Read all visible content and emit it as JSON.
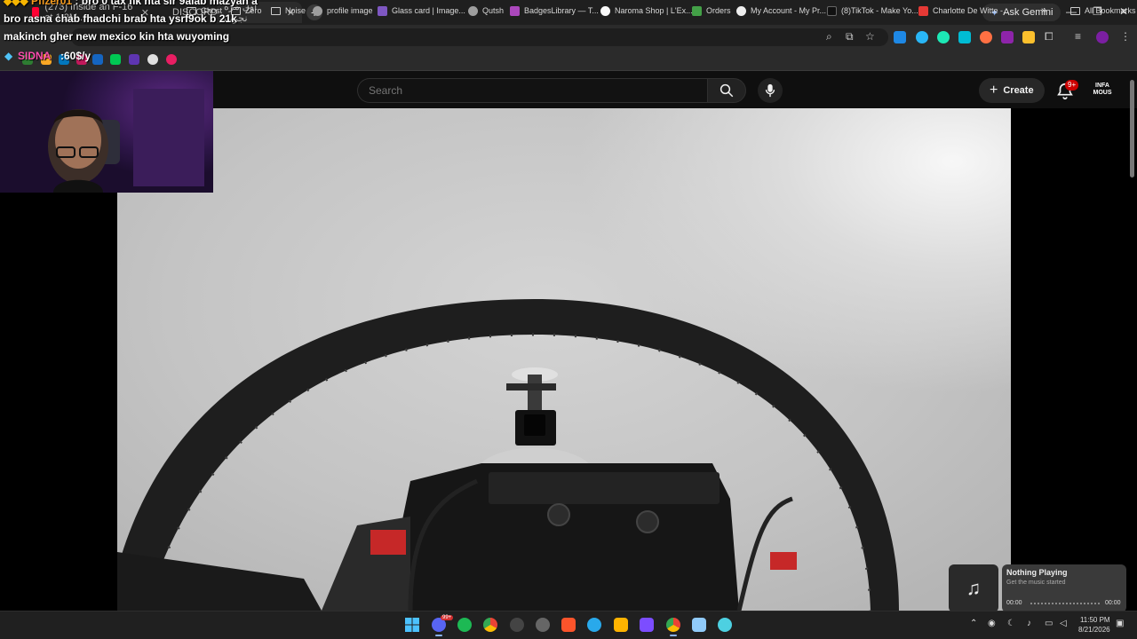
{
  "browser": {
    "tabs": [
      {
        "label": "(273) Inside an F-16 at 1.2M..."
      },
      {
        "label": "DISCORD"
      },
      {
        "label": "أول مرة نجرب"
      }
    ],
    "ask_gemini": "Ask Gemini",
    "bookmarks": [
      {
        "label": "Ghost",
        "icon": "folder-icon"
      },
      {
        "label": "Zero",
        "icon": "folder-icon"
      },
      {
        "label": "Noise",
        "icon": "folder-icon"
      },
      {
        "label": "profile image",
        "icon": "globe-icon"
      },
      {
        "label": "Glass card | Image...",
        "icon": "glass-icon"
      },
      {
        "label": "Qutsh",
        "icon": "globe-icon"
      },
      {
        "label": "BadgesLibrary — T...",
        "icon": "badge-icon"
      },
      {
        "label": "Naroma Shop | L'Ex...",
        "icon": "shop-icon"
      },
      {
        "label": "Orders",
        "icon": "orders-icon"
      },
      {
        "label": "My Account - My Pr...",
        "icon": "account-icon"
      },
      {
        "label": "(8)TikTok - Make Yo...",
        "icon": "tiktok-icon"
      },
      {
        "label": "Charlotte De Witte -...",
        "icon": "music-icon"
      }
    ],
    "all_bookmarks": "All Bookmarks"
  },
  "site": {
    "search_placeholder": "Search",
    "create_label": "Create",
    "notifications": "9+",
    "avatar_text": "INFA MOUS"
  },
  "overlay": {
    "chat": [
      {
        "user": "Pfizer01",
        "text": ": bro 0 tax fik hta sir 9alab mazyan a"
      },
      {
        "user": "",
        "text": "bro rasna chab fhadchi brab hta ysrf9ok b 21k"
      },
      {
        "user": "",
        "text": "makinch gher new mexico kin hta wuyoming"
      }
    ],
    "sidna_label": "SIDNA",
    "sidna_value": ":60$/y"
  },
  "music": {
    "title": "Nothing Playing",
    "subtitle": "Get the music started",
    "time_start": "00:00",
    "time_end": "00:00"
  },
  "taskbar": {
    "time": "11:50 PM",
    "date": "8/21/2026",
    "discord_badge": "99+"
  },
  "colors": {
    "accent": "#ff0033",
    "bell_badge": "#cc0000",
    "chat_user": "#f59b1f",
    "sidna": "#ff4fb0"
  }
}
